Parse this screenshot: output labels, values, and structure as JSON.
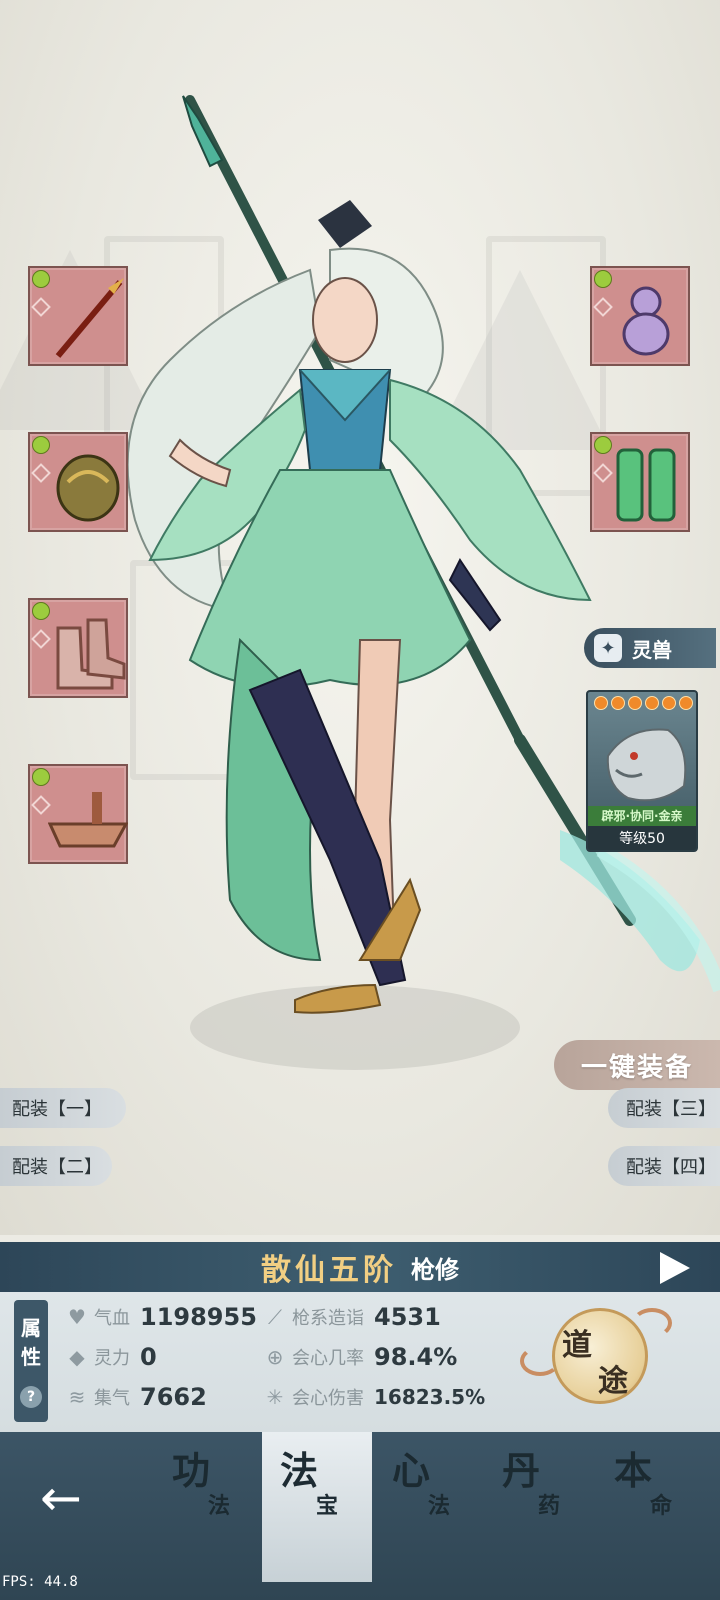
{
  "pet": {
    "tab_label": "灵兽",
    "traits": "辟邪·协同·金亲",
    "level": "等级50",
    "stars": 6
  },
  "actions": {
    "equip_all": "一键装备"
  },
  "loadouts": [
    "配装【一】",
    "配装【二】",
    "配装【三】",
    "配装【四】"
  ],
  "realm": {
    "name": "散仙五阶",
    "class": "枪修"
  },
  "attributes": {
    "tab_label_1": "属",
    "tab_label_2": "性",
    "help": "?",
    "stats": [
      {
        "icon": "heart-icon",
        "label": "气血",
        "value": "1198955"
      },
      {
        "icon": "spear-icon",
        "label": "枪系造诣",
        "value": "4531"
      },
      {
        "icon": "drop-icon",
        "label": "灵力",
        "value": "0"
      },
      {
        "icon": "crit-rate-icon",
        "label": "会心几率",
        "value": "98.4%"
      },
      {
        "icon": "swirl-icon",
        "label": "集气",
        "value": "7662"
      },
      {
        "icon": "crit-damage-icon",
        "label": "会心伤害",
        "value": "16823.5%"
      }
    ]
  },
  "daotu": {
    "char1": "道",
    "char2": "途"
  },
  "nav": {
    "tabs": [
      {
        "big": "功",
        "small": "法"
      },
      {
        "big": "法",
        "small": "宝"
      },
      {
        "big": "心",
        "small": "法"
      },
      {
        "big": "丹",
        "small": "药"
      },
      {
        "big": "本",
        "small": "命"
      }
    ],
    "active_index": 1
  },
  "fps": "FPS: 44.8"
}
